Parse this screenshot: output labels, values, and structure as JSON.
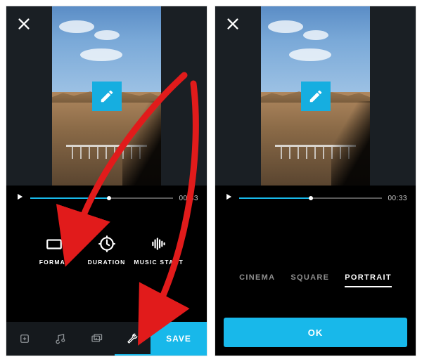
{
  "colors": {
    "accent": "#18b8ea",
    "arrow": "#e11b1b"
  },
  "left_screen": {
    "timecode": "00:33",
    "tools": [
      {
        "name": "format",
        "label": "FORMAT"
      },
      {
        "name": "duration",
        "label": "DURATION"
      },
      {
        "name": "music_start",
        "label": "MUSIC START"
      }
    ],
    "bottom_bar": {
      "tabs": [
        "add-clip",
        "music",
        "slideshow",
        "tools"
      ],
      "active_tab": "tools",
      "save_label": "SAVE"
    }
  },
  "right_screen": {
    "timecode": "00:33",
    "format_options": [
      {
        "label": "CINEMA",
        "selected": false
      },
      {
        "label": "SQUARE",
        "selected": false
      },
      {
        "label": "PORTRAIT",
        "selected": true
      }
    ],
    "ok_label": "OK"
  }
}
